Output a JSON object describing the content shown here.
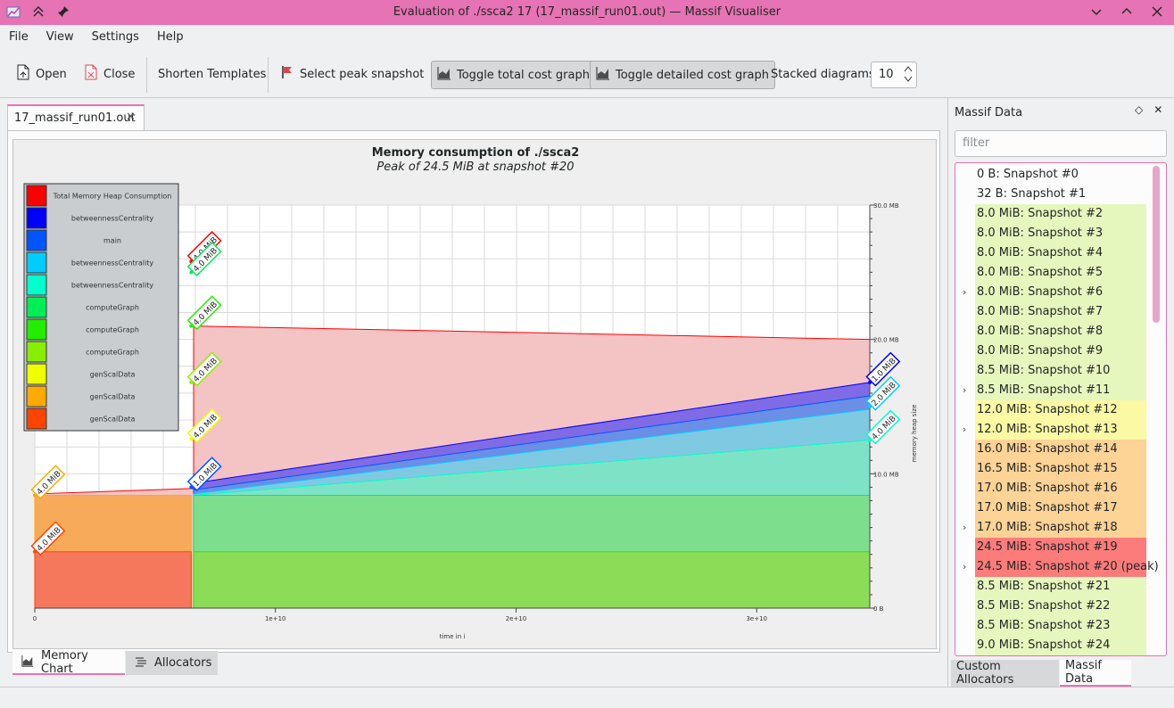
{
  "window": {
    "title": "Evaluation of ./ssca2 17 (17_massif_run01.out) — Massif Visualiser"
  },
  "menu": [
    "File",
    "View",
    "Settings",
    "Help"
  ],
  "toolbar": {
    "open": "Open",
    "close": "Close",
    "shorten": "Shorten Templates",
    "peak": "Select peak snapshot",
    "toggle_total": "Toggle total cost graph",
    "toggle_detailed": "Toggle detailed cost graph",
    "stacked_label": "Stacked diagrams:",
    "stacked_value": "10"
  },
  "document_tab": {
    "label": "17_massif_run01.out",
    "close": "✕"
  },
  "chart_data": {
    "type": "area",
    "title": "Memory consumption of ./ssca2",
    "subtitle": "Peak of 24.5 MiB at snapshot #20",
    "xlabel": "time in i",
    "ylabel": "memory heap size",
    "x_ticks": [
      "0",
      "1e+10",
      "2e+10",
      "3e+10"
    ],
    "y_ticks": [
      "0 B",
      "10.0 MB",
      "20.0 MB",
      "30.0 MB"
    ],
    "xlim": [
      0,
      34700000000
    ],
    "ylim": [
      0,
      30
    ],
    "legend": [
      {
        "label": "Total Memory Heap Consumption",
        "color": "#ff0000"
      },
      {
        "label": "betweennessCentrality",
        "color": "#0000ff"
      },
      {
        "label": "main",
        "color": "#0055ff"
      },
      {
        "label": "betweennessCentrality",
        "color": "#00ccff"
      },
      {
        "label": "betweennessCentrality",
        "color": "#00ffcc"
      },
      {
        "label": "computeGraph",
        "color": "#00ee55"
      },
      {
        "label": "computeGraph",
        "color": "#22ee00"
      },
      {
        "label": "computeGraph",
        "color": "#88ee00"
      },
      {
        "label": "genScalData",
        "color": "#eeff00"
      },
      {
        "label": "genScalData",
        "color": "#ffaa00"
      },
      {
        "label": "genScalData",
        "color": "#ff4400"
      }
    ],
    "series": [
      {
        "name": "Total Memory Heap Consumption",
        "color": "#ff0000",
        "fill": "#f4c3c4",
        "x": [
          0,
          6500000000,
          6600000000,
          6600000000,
          34700000000
        ],
        "y": [
          8.5,
          8.9,
          8.9,
          21.0,
          20.0
        ]
      },
      {
        "name": "betweennessCentrality",
        "color": "#0000ff",
        "fill": "#7f6be6",
        "x": [
          6600000000,
          34700000000
        ],
        "y": [
          9.3,
          16.8
        ]
      },
      {
        "name": "main",
        "color": "#0055ff",
        "fill": "#6b8ee6",
        "x": [
          6600000000,
          34700000000
        ],
        "y": [
          8.8,
          15.8
        ]
      },
      {
        "name": "betweennessCentrality",
        "color": "#00ccff",
        "fill": "#7fc9e3",
        "x": [
          6600000000,
          34700000000
        ],
        "y": [
          8.5,
          14.8
        ]
      },
      {
        "name": "betweennessCentrality",
        "color": "#00ffcc",
        "fill": "#7ee3c6",
        "x": [
          6600000000,
          34700000000
        ],
        "y": [
          8.4,
          12.5
        ]
      },
      {
        "name": "computeGraph",
        "color": "#00ee55",
        "fill": "#7ddf8e",
        "x": [
          6600000000,
          34700000000
        ],
        "y": [
          8.4,
          8.4
        ]
      },
      {
        "name": "computeGraph",
        "color": "#22ee00",
        "fill": "#8cdc57",
        "x": [
          6600000000,
          34700000000
        ],
        "y": [
          4.2,
          4.2
        ]
      },
      {
        "name": "genScalData",
        "color": "#ffaa00",
        "fill": "#f7aa5a",
        "x": [
          0,
          6500000000
        ],
        "y": [
          8.4,
          8.4
        ]
      },
      {
        "name": "genScalData",
        "color": "#ff4400",
        "fill": "#f5785c",
        "x": [
          0,
          6500000000
        ],
        "y": [
          4.2,
          4.2
        ]
      }
    ],
    "annotations": [
      {
        "text": "4.0 MiB",
        "color": "#ff0000",
        "x": 6500000000,
        "y": 25.8
      },
      {
        "text": "4.0 MiB",
        "color": "#00ee55",
        "x": 6500000000,
        "y": 25.0
      },
      {
        "text": "4.0 MiB",
        "color": "#22ee00",
        "x": 6500000000,
        "y": 21.0
      },
      {
        "text": "4.0 MiB",
        "color": "#88ee00",
        "x": 6500000000,
        "y": 16.8
      },
      {
        "text": "4.0 MiB",
        "color": "#eeff00",
        "x": 6500000000,
        "y": 12.6
      },
      {
        "text": "1.0 MiB",
        "color": "#0055ff",
        "x": 6500000000,
        "y": 9.0
      },
      {
        "text": "4.0 MiB",
        "color": "#ffaa00",
        "x": 0,
        "y": 8.4
      },
      {
        "text": "4.0 MiB",
        "color": "#ff4400",
        "x": 0,
        "y": 4.2
      },
      {
        "text": "1.0 MiB",
        "color": "#0000ff",
        "x": 34700000000,
        "y": 16.8
      },
      {
        "text": "2.0 MiB",
        "color": "#00ccff",
        "x": 34700000000,
        "y": 15.0
      },
      {
        "text": "4.0 MiB",
        "color": "#00ffcc",
        "x": 34700000000,
        "y": 12.5
      }
    ]
  },
  "bottom_tabs": [
    "Memory Chart",
    "Allocators"
  ],
  "dock": {
    "title": "Massif Data",
    "filter_placeholder": "filter",
    "snapshots": [
      {
        "label": "0 B: Snapshot #0",
        "bg": "#fcfcfc",
        "expandable": false
      },
      {
        "label": "32 B: Snapshot #1",
        "bg": "#fcfcfc",
        "expandable": false
      },
      {
        "label": "8.0 MiB: Snapshot #2",
        "bg": "#e6f7bd",
        "expandable": false
      },
      {
        "label": "8.0 MiB: Snapshot #3",
        "bg": "#e6f7bd",
        "expandable": false
      },
      {
        "label": "8.0 MiB: Snapshot #4",
        "bg": "#e6f7bd",
        "expandable": false
      },
      {
        "label": "8.0 MiB: Snapshot #5",
        "bg": "#e6f7bd",
        "expandable": false
      },
      {
        "label": "8.0 MiB: Snapshot #6",
        "bg": "#e6f7bd",
        "expandable": true
      },
      {
        "label": "8.0 MiB: Snapshot #7",
        "bg": "#e6f7bd",
        "expandable": false
      },
      {
        "label": "8.0 MiB: Snapshot #8",
        "bg": "#e6f7bd",
        "expandable": false
      },
      {
        "label": "8.0 MiB: Snapshot #9",
        "bg": "#e6f7bd",
        "expandable": false
      },
      {
        "label": "8.5 MiB: Snapshot #10",
        "bg": "#e6f7bd",
        "expandable": false
      },
      {
        "label": "8.5 MiB: Snapshot #11",
        "bg": "#e6f7bd",
        "expandable": true
      },
      {
        "label": "12.0 MiB: Snapshot #12",
        "bg": "#fbf9a3",
        "expandable": false
      },
      {
        "label": "12.0 MiB: Snapshot #13",
        "bg": "#fbf9a3",
        "expandable": true
      },
      {
        "label": "16.0 MiB: Snapshot #14",
        "bg": "#fdd396",
        "expandable": false
      },
      {
        "label": "16.5 MiB: Snapshot #15",
        "bg": "#fdd396",
        "expandable": false
      },
      {
        "label": "17.0 MiB: Snapshot #16",
        "bg": "#fdd396",
        "expandable": false
      },
      {
        "label": "17.0 MiB: Snapshot #17",
        "bg": "#fdd396",
        "expandable": false
      },
      {
        "label": "17.0 MiB: Snapshot #18",
        "bg": "#fdd396",
        "expandable": true
      },
      {
        "label": "24.5 MiB: Snapshot #19",
        "bg": "#fb7c7a",
        "expandable": false
      },
      {
        "label": "24.5 MiB: Snapshot #20 (peak)",
        "bg": "#fb7c7a",
        "expandable": true
      },
      {
        "label": "8.5 MiB: Snapshot #21",
        "bg": "#e6f7bd",
        "expandable": false
      },
      {
        "label": "8.5 MiB: Snapshot #22",
        "bg": "#e6f7bd",
        "expandable": false
      },
      {
        "label": "8.5 MiB: Snapshot #23",
        "bg": "#e6f7bd",
        "expandable": false
      },
      {
        "label": "9.0 MiB: Snapshot #24",
        "bg": "#e6f7bd",
        "expandable": false
      }
    ],
    "tabs": [
      "Custom Allocators",
      "Massif Data"
    ]
  }
}
